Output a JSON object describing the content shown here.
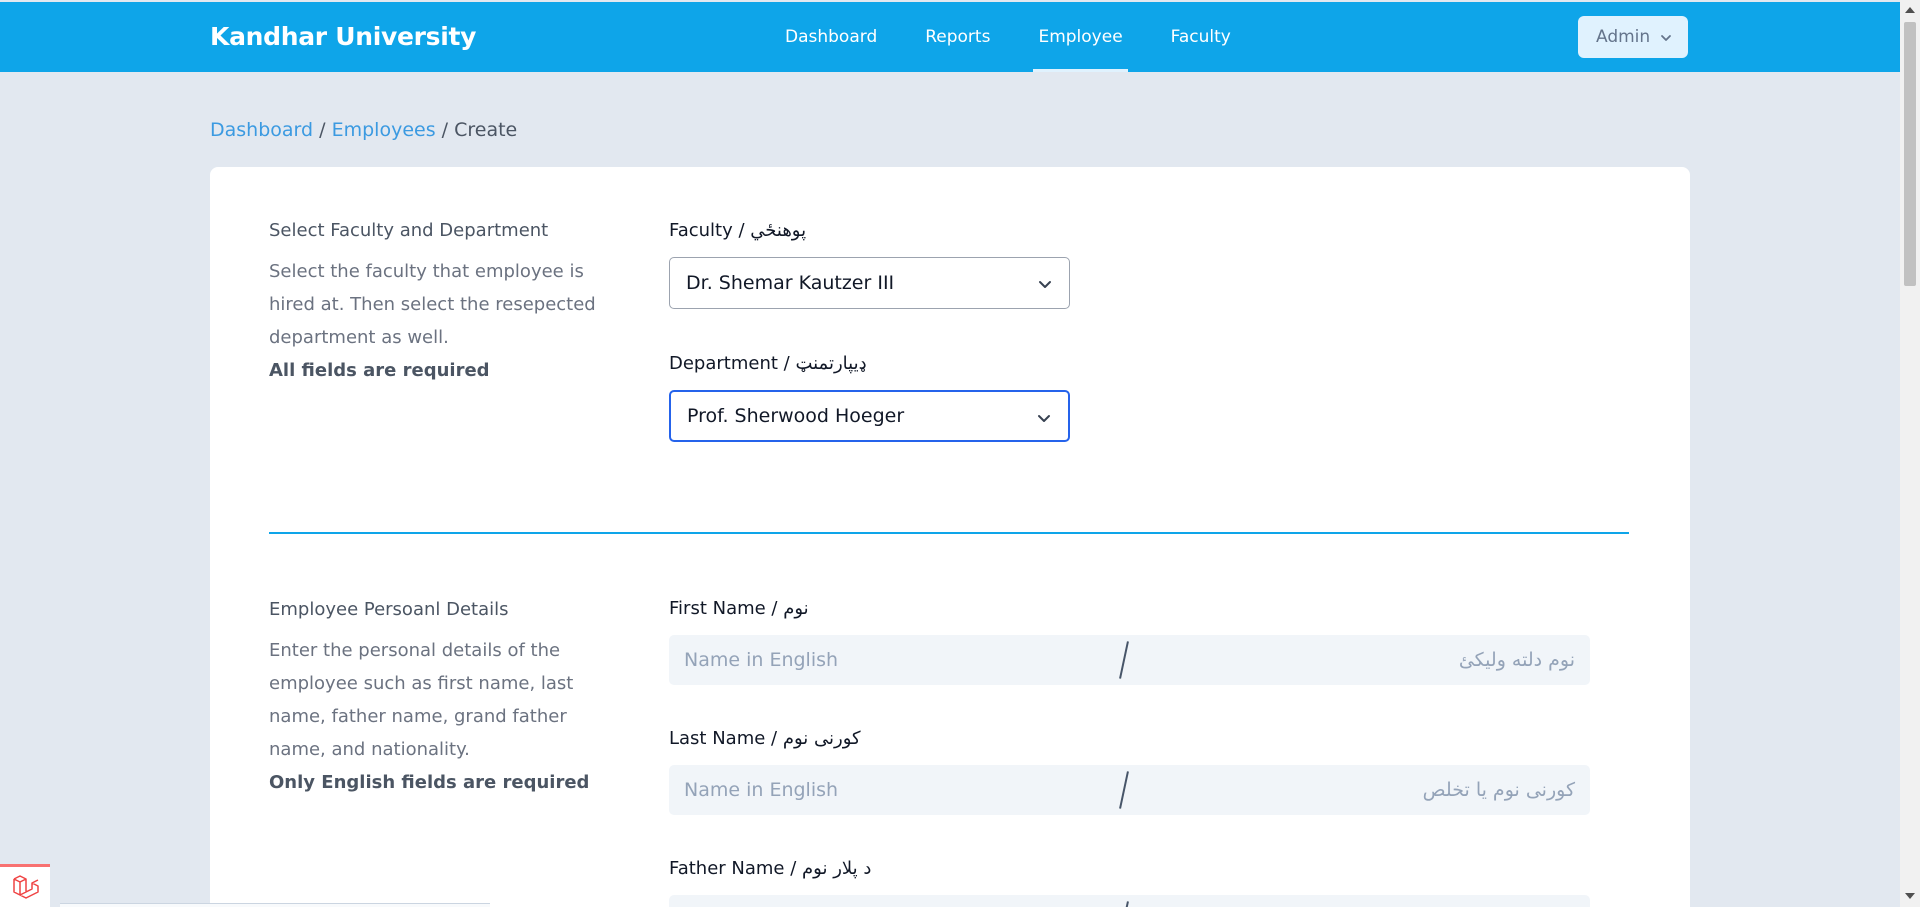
{
  "header": {
    "brand": "Kandhar University",
    "nav": [
      {
        "label": "Dashboard",
        "active": false
      },
      {
        "label": "Reports",
        "active": false
      },
      {
        "label": "Employee",
        "active": true
      },
      {
        "label": "Faculty",
        "active": false
      }
    ],
    "user_menu": "Admin",
    "accent_color": "#0ea5e9"
  },
  "breadcrumb": {
    "items": [
      "Dashboard",
      "Employees",
      "Create"
    ],
    "separator": "/"
  },
  "faculty_section": {
    "title": "Select Faculty and Department",
    "description": "Select the faculty that employee is hired at. Then select the resepected department as well.",
    "required_note": "All fields are required",
    "faculty_label": "Faculty / پوهنځي",
    "faculty_value": "Dr. Shemar Kautzer III",
    "department_label": "Department / ډيپارتمنټ",
    "department_value": "Prof. Sherwood Hoeger"
  },
  "personal_section": {
    "title": "Employee Persoanl Details",
    "description": "Enter the personal details of the employee such as first name, last name, father name, grand father name, and nationality.",
    "required_note": "Only English fields are required",
    "first_name": {
      "label": "First Name / نوم",
      "en_placeholder": "Name in English",
      "ps_placeholder": "نوم دلته وليکئ"
    },
    "last_name": {
      "label": "Last Name / کورنی نوم",
      "en_placeholder": "Name in English",
      "ps_placeholder": "کورنی نوم یا تخلص"
    },
    "father_name": {
      "label": "Father Name / د پلار نوم"
    }
  },
  "icons": [
    "chevron-down-icon",
    "laravel-logo-icon"
  ]
}
